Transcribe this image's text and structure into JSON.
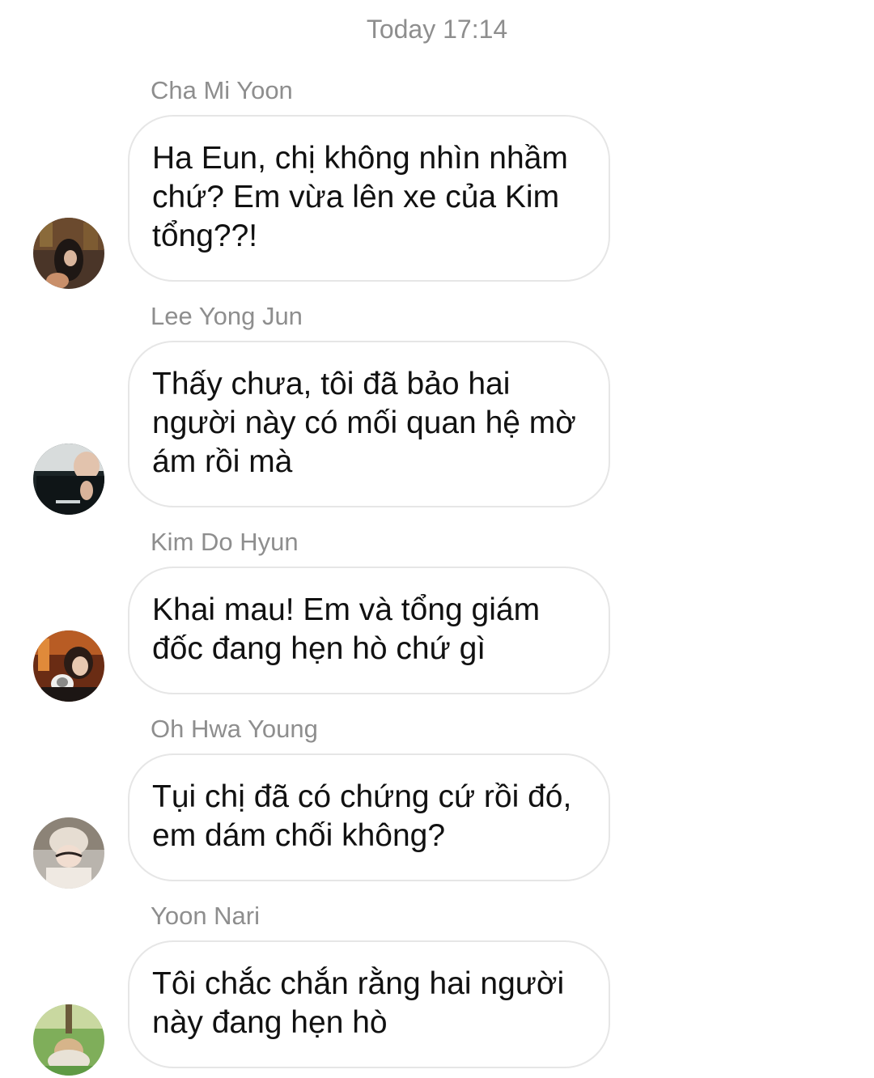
{
  "chat": {
    "timestamp": "Today 17:14",
    "messages": [
      {
        "sender": "Cha Mi Yoon",
        "text": "Ha Eun, chị không nhìn nhầm\nchứ? Em vừa lên xe của Kim\ntổng??!",
        "avatar": "avatar-photo-icon"
      },
      {
        "sender": "Lee Yong Jun",
        "text": "Thấy chưa, tôi đã bảo hai\nngười này có mối quan hệ mờ\nám rồi mà",
        "avatar": "avatar-photo-icon"
      },
      {
        "sender": "Kim Do Hyun",
        "text": "Khai mau! Em và tổng giám\nđốc đang hẹn hò chứ gì",
        "avatar": "avatar-photo-icon"
      },
      {
        "sender": "Oh Hwa Young",
        "text": "Tụi chị đã có chứng cứ rồi đó,\nem dám chối không?",
        "avatar": "avatar-photo-icon"
      },
      {
        "sender": "Yoon Nari",
        "text": "Tôi chắc chắn rằng hai người\nnày đang hẹn hò",
        "avatar": "avatar-photo-icon"
      }
    ]
  },
  "colors": {
    "background": "#ffffff",
    "meta_text": "#8e8e8e",
    "bubble_border": "#e6e6e6",
    "message_text": "#111111"
  }
}
